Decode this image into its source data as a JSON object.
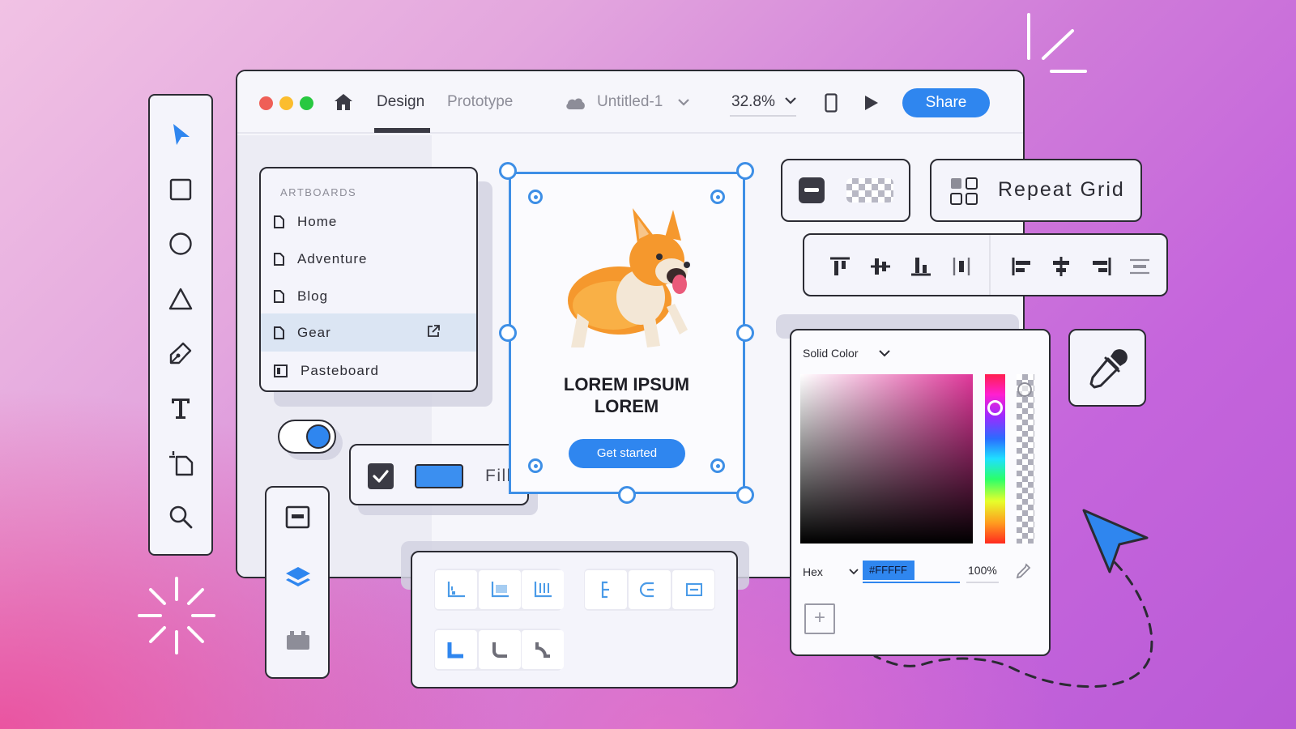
{
  "window": {
    "tabs": {
      "design": "Design",
      "prototype": "Prototype"
    },
    "document_name": "Untitled-1",
    "zoom": "32.8%",
    "share_label": "Share",
    "traffic_colors": [
      "#ef5f57",
      "#fbbd2e",
      "#28c840"
    ]
  },
  "toolbar": {
    "tools": [
      "select-icon",
      "rectangle-icon",
      "ellipse-icon",
      "polygon-icon",
      "pen-icon",
      "text-icon",
      "artboard-icon",
      "zoom-icon"
    ]
  },
  "artboards": {
    "heading": "ARTBOARDS",
    "items": [
      {
        "label": "Home",
        "active": false
      },
      {
        "label": "Adventure",
        "active": false
      },
      {
        "label": "Blog",
        "active": false
      },
      {
        "label": "Gear",
        "active": true
      },
      {
        "label": "Pasteboard",
        "active": false
      }
    ]
  },
  "fill": {
    "label": "Fill",
    "checked": true,
    "color": "#3b8ff0"
  },
  "preview": {
    "headline_line1": "LOREM IPSUM",
    "headline_line2": "LOREM",
    "cta_label": "Get started",
    "cta_color": "#2f86ef"
  },
  "repeat_grid": {
    "label": "Repeat Grid"
  },
  "color_picker": {
    "mode": "Solid Color",
    "format": "Hex",
    "hex_value": "#FFFFF",
    "opacity": "100%",
    "hue": "#e0379a"
  },
  "accent": "#3e8fe6"
}
